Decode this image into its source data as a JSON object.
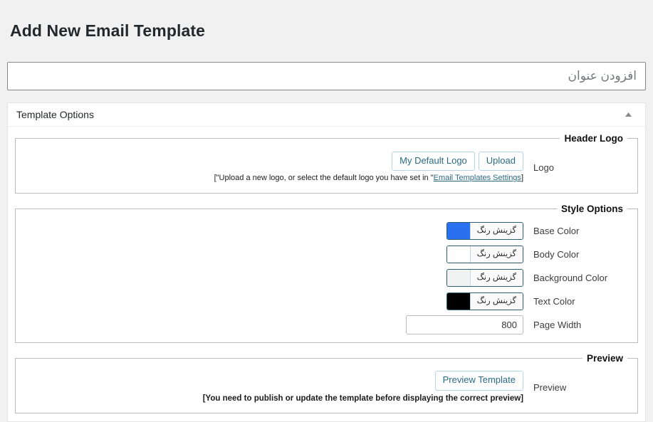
{
  "page": {
    "heading": "Add New Email Template",
    "title_placeholder": "افزودن عنوان",
    "title_value": ""
  },
  "metabox": {
    "title": "Template Options",
    "toggle_icon": "triangle-up-icon"
  },
  "header_logo": {
    "legend": "Header Logo",
    "label": "Logo",
    "default_logo_button": "My Default Logo",
    "upload_button": "Upload",
    "hint_prefix": "[\"Upload a new logo, or select the default logo you have set in \"",
    "hint_link": "Email Templates Settings",
    "hint_suffix": "]"
  },
  "style_options": {
    "legend": "Style Options",
    "color_button_label": "گزینش رنگ",
    "rows": [
      {
        "label": "Base Color",
        "type": "color",
        "value": "#2a71f2"
      },
      {
        "label": "Body Color",
        "type": "color",
        "value": "#ffffff"
      },
      {
        "label": "Background Color",
        "type": "color",
        "value": "#f1f2f2"
      },
      {
        "label": "Text Color",
        "type": "color",
        "value": "#000000"
      }
    ],
    "page_width": {
      "label": "Page Width",
      "value": "800"
    }
  },
  "preview": {
    "legend": "Preview",
    "label": "Preview",
    "button": "Preview Template",
    "note": "[You need to publish or update the template before displaying the correct preview]"
  },
  "colors": {
    "page_bg": "#f1f1f1",
    "panel_bg": "#ffffff",
    "button_text": "#2b6a86",
    "button_border": "#a9d5e2"
  }
}
